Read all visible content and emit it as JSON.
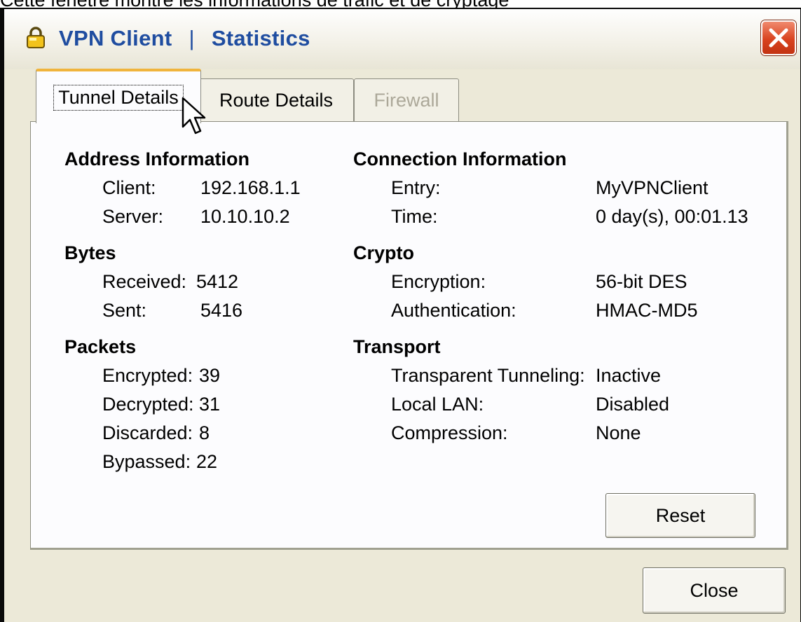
{
  "caption": "Cette fenêtre montre les informations de trafic et de cryptage",
  "window": {
    "app_title": "VPN Client",
    "separator": "|",
    "page_title": "Statistics",
    "close_icon": "close-x-icon",
    "lock_icon": "padlock-icon"
  },
  "tabs": [
    {
      "label": "Tunnel Details",
      "state": "active"
    },
    {
      "label": "Route Details",
      "state": "normal"
    },
    {
      "label": "Firewall",
      "state": "disabled"
    }
  ],
  "address_information": {
    "title": "Address Information",
    "client_label": "Client:",
    "client_value": "192.168.1.1",
    "server_label": "Server:",
    "server_value": "10.10.10.2"
  },
  "bytes": {
    "title": "Bytes",
    "received_label": "Received:",
    "received_value": "5412",
    "sent_label": "Sent:",
    "sent_value": "5416"
  },
  "packets": {
    "title": "Packets",
    "encrypted_label": "Encrypted:",
    "encrypted_value": "39",
    "decrypted_label": "Decrypted:",
    "decrypted_value": "31",
    "discarded_label": "Discarded:",
    "discarded_value": "8",
    "bypassed_label": "Bypassed:",
    "bypassed_value": "22"
  },
  "connection_information": {
    "title": "Connection Information",
    "entry_label": "Entry:",
    "entry_value": "MyVPNClient",
    "time_label": "Time:",
    "time_value": "0 day(s), 00:01.13"
  },
  "crypto": {
    "title": "Crypto",
    "encryption_label": "Encryption:",
    "encryption_value": "56-bit DES",
    "authentication_label": "Authentication:",
    "authentication_value": "HMAC-MD5"
  },
  "transport": {
    "title": "Transport",
    "tunneling_label": "Transparent Tunneling:",
    "tunneling_value": "Inactive",
    "local_lan_label": "Local LAN:",
    "local_lan_value": "Disabled",
    "compression_label": "Compression:",
    "compression_value": "None"
  },
  "buttons": {
    "reset": "Reset",
    "close": "Close"
  },
  "colors": {
    "title_text": "#1f4da0",
    "window_face": "#ece9d8",
    "panel_bg": "#fcfcfe",
    "close_button": "#d9431f",
    "active_tab_highlight": "#f0b43c",
    "disabled_text": "#aca899"
  }
}
